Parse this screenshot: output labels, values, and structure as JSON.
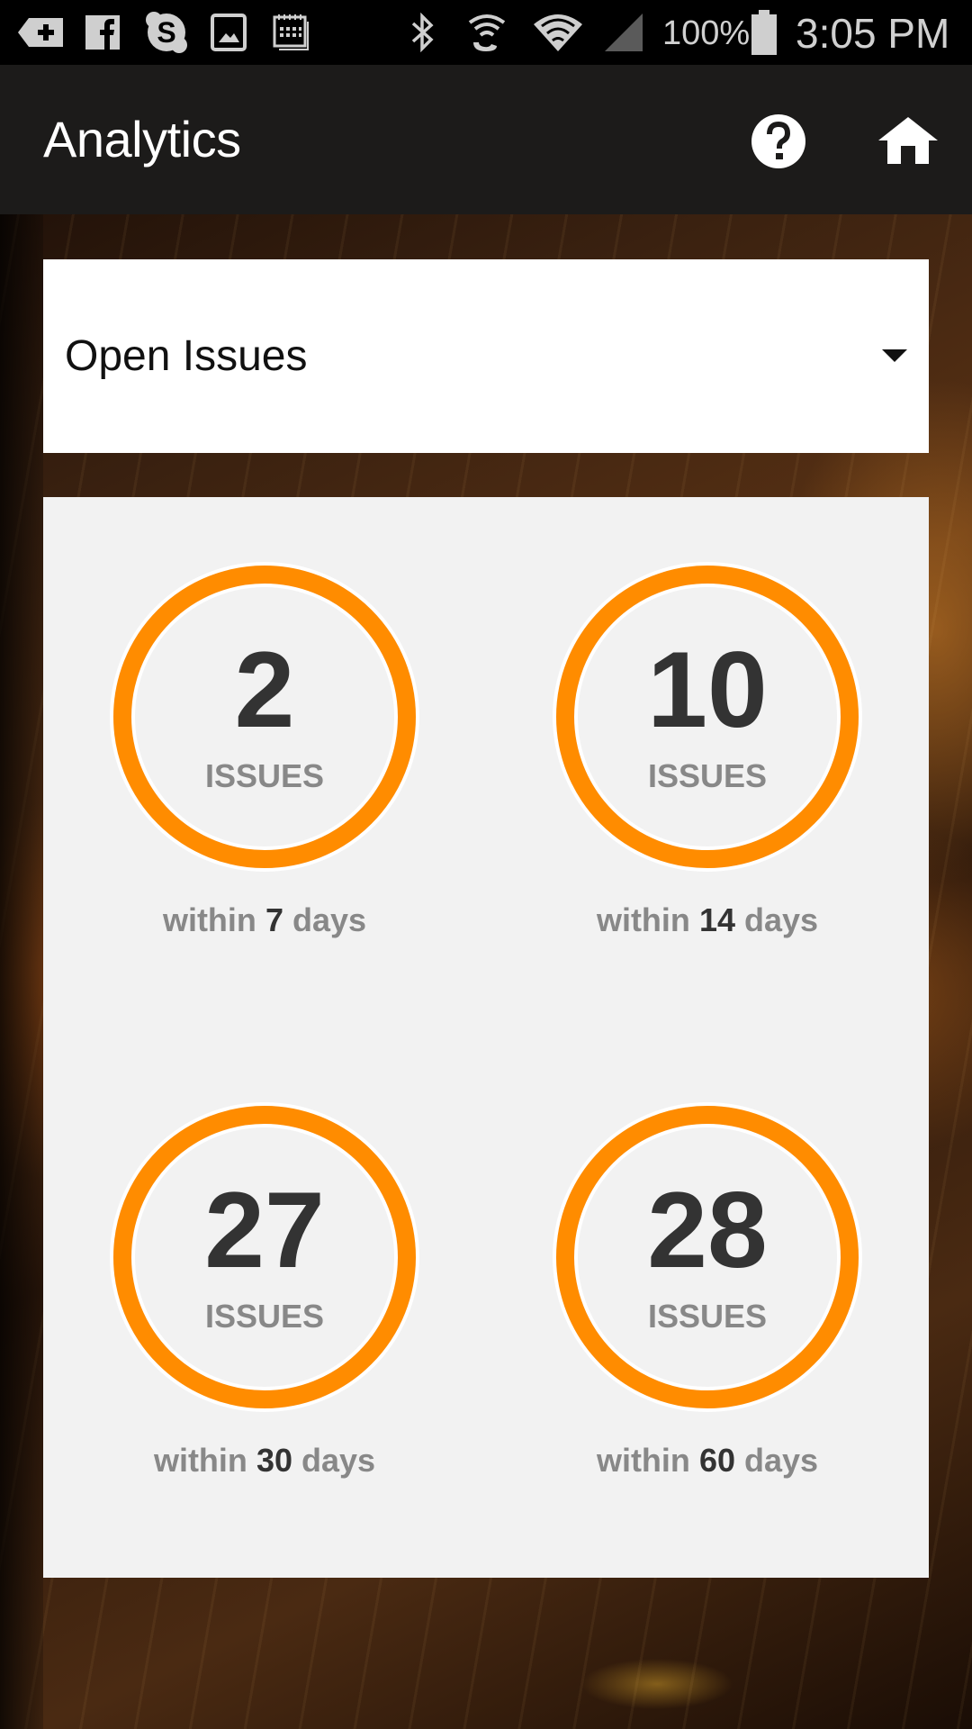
{
  "status_bar": {
    "notification_icons": [
      "add-tag-icon",
      "facebook-icon",
      "skype-icon",
      "gallery-icon",
      "calendar-icon"
    ],
    "system_icons": [
      "bluetooth-icon",
      "nfc-wifi-calling-icon",
      "wifi-icon",
      "cell-signal-icon"
    ],
    "battery_percent": "100%",
    "time": "3:05 PM"
  },
  "app_bar": {
    "title": "Analytics",
    "help_icon": "help-circle-icon",
    "home_icon": "home-icon",
    "background_color": "#1c1b1a"
  },
  "filter": {
    "selected": "Open Issues"
  },
  "stats": {
    "accent_color": "#ff8c00",
    "items": [
      {
        "count": "2",
        "unit": "ISSUES",
        "prefix": "within",
        "days": "7",
        "suffix": "days"
      },
      {
        "count": "10",
        "unit": "ISSUES",
        "prefix": "within",
        "days": "14",
        "suffix": "days"
      },
      {
        "count": "27",
        "unit": "ISSUES",
        "prefix": "within",
        "days": "30",
        "suffix": "days"
      },
      {
        "count": "28",
        "unit": "ISSUES",
        "prefix": "within",
        "days": "60",
        "suffix": "days"
      }
    ]
  }
}
